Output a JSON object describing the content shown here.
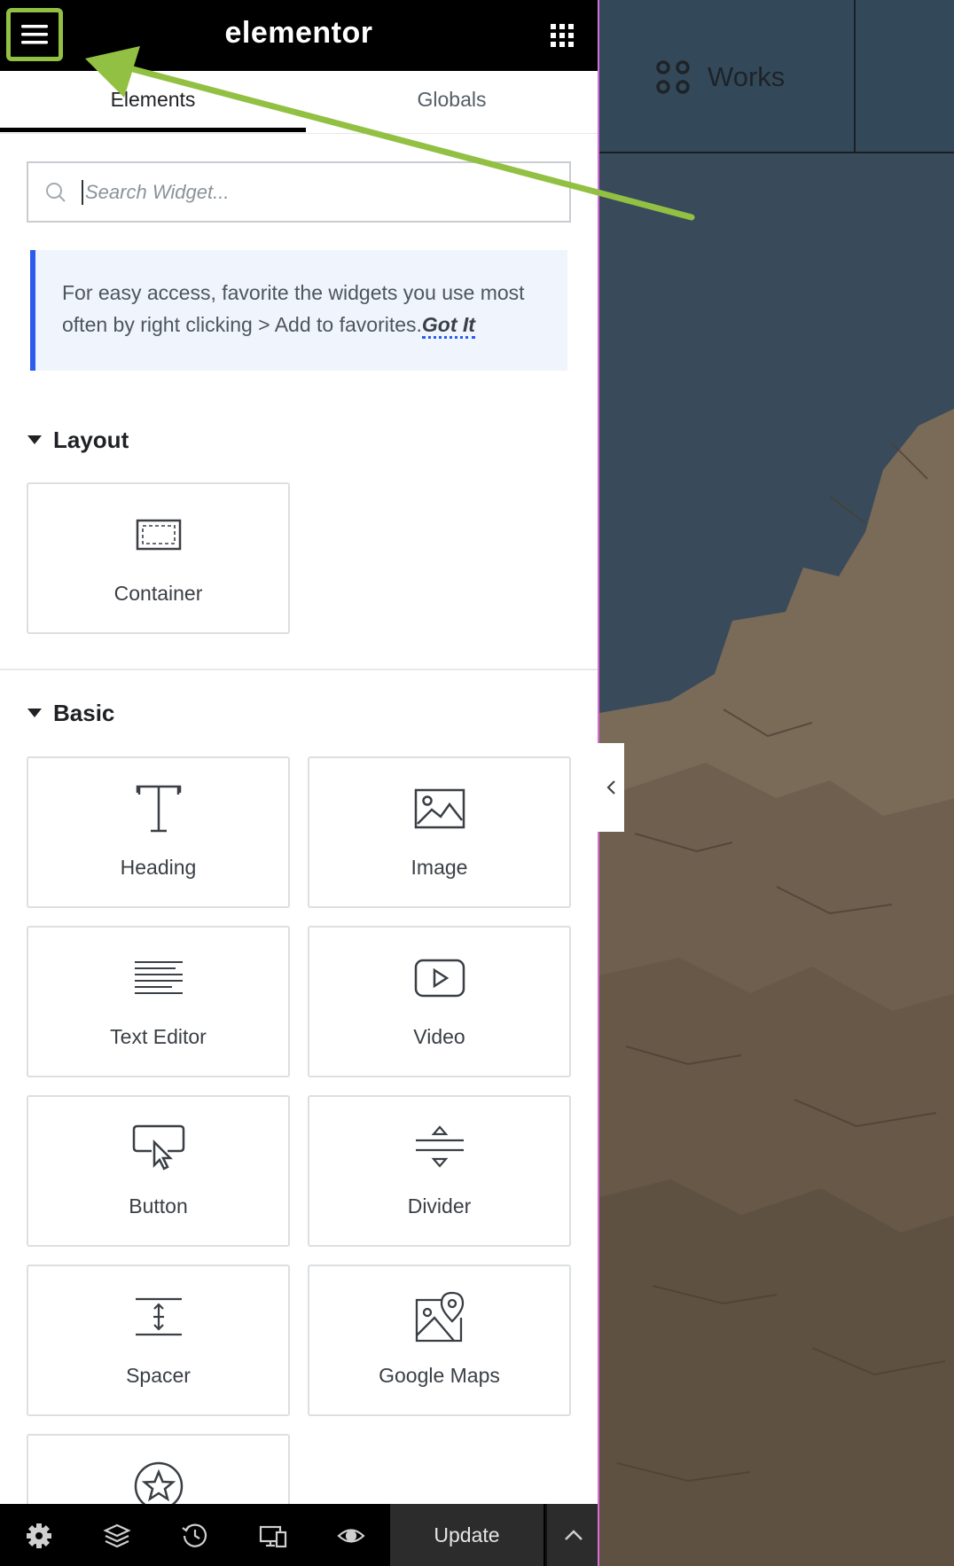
{
  "header": {
    "brand": "elementor",
    "menu_icon": "hamburger-menu-icon",
    "apps_icon": "grid-apps-icon",
    "highlight_color": "#92c043"
  },
  "tabs": [
    {
      "label": "Elements",
      "active": true
    },
    {
      "label": "Globals",
      "active": false
    }
  ],
  "search": {
    "placeholder": "Search Widget..."
  },
  "notice": {
    "text": "For easy access, favorite the widgets you use most often by right clicking > Add to favorites.",
    "link": "Got It"
  },
  "sections": {
    "layout": {
      "title": "Layout",
      "widgets": [
        {
          "label": "Container",
          "icon": "container-icon"
        }
      ]
    },
    "basic": {
      "title": "Basic",
      "widgets": [
        {
          "label": "Heading",
          "icon": "heading-icon"
        },
        {
          "label": "Image",
          "icon": "image-icon"
        },
        {
          "label": "Text Editor",
          "icon": "text-editor-icon"
        },
        {
          "label": "Video",
          "icon": "video-icon"
        },
        {
          "label": "Button",
          "icon": "button-icon"
        },
        {
          "label": "Divider",
          "icon": "divider-icon"
        },
        {
          "label": "Spacer",
          "icon": "spacer-icon"
        },
        {
          "label": "Google Maps",
          "icon": "google-maps-icon"
        },
        {
          "label": "",
          "icon": "star-icon"
        }
      ]
    }
  },
  "bottom_bar": {
    "icons": [
      "settings-icon",
      "navigator-layers-icon",
      "history-icon",
      "responsive-mode-icon",
      "preview-eye-icon"
    ],
    "update_label": "Update",
    "expand_icon": "chevron-up-icon"
  },
  "preview": {
    "nav_label": "Works",
    "nav_icon": "four-dots-icon",
    "collapse_icon": "chevron-left-icon",
    "sky_color": "#394b5a",
    "rock_color": "#7a6a58"
  },
  "annotation": {
    "arrow_color": "#92c043"
  }
}
